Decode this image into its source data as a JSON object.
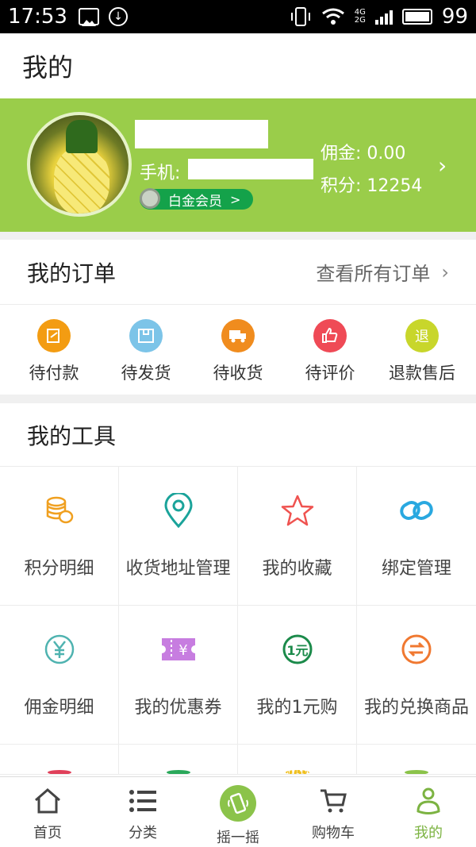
{
  "status_bar": {
    "time": "17:53",
    "battery": "99"
  },
  "header": {
    "title": "我的"
  },
  "profile": {
    "phone_label": "手机:",
    "member_level": "白金会员",
    "member_chevron": ">",
    "commission": "佣金: 0.00",
    "points": "积分: 12254"
  },
  "orders": {
    "title": "我的订单",
    "view_all": "查看所有订单",
    "items": [
      {
        "label": "待付款",
        "color": "#f39c12",
        "icon": "wallet-icon"
      },
      {
        "label": "待发货",
        "color": "#7cc4e8",
        "icon": "box-icon"
      },
      {
        "label": "待收货",
        "color": "#f08c1e",
        "icon": "truck-icon"
      },
      {
        "label": "待评价",
        "color": "#ef4a56",
        "icon": "thumbs-up-icon"
      },
      {
        "label": "退款售后",
        "color": "#c8d62b",
        "icon_text": "退",
        "icon": "refund-icon"
      }
    ]
  },
  "tools": {
    "title": "我的工具",
    "items": [
      {
        "label": "积分明细",
        "icon": "coins-icon",
        "color": "#f0a020"
      },
      {
        "label": "收货地址管理",
        "icon": "location-pin-icon",
        "color": "#1aa39a"
      },
      {
        "label": "我的收藏",
        "icon": "star-icon",
        "color": "#ef5350"
      },
      {
        "label": "绑定管理",
        "icon": "link-icon",
        "color": "#29a8e0"
      },
      {
        "label": "佣金明细",
        "icon": "yen-circle-icon",
        "color": "#4fb3b0"
      },
      {
        "label": "我的优惠券",
        "icon": "coupon-icon",
        "color": "#c77de0"
      },
      {
        "label": "我的1元购",
        "icon": "one-yuan-icon",
        "color": "#1b8a4a"
      },
      {
        "label": "我的兑换商品",
        "icon": "exchange-icon",
        "color": "#f07830"
      }
    ],
    "partial_colors": [
      "#e0405a",
      "#2aa85a",
      "#f0c020",
      "#8bc34a"
    ]
  },
  "tabbar": {
    "items": [
      {
        "label": "首页",
        "icon": "home-icon"
      },
      {
        "label": "分类",
        "icon": "list-icon"
      },
      {
        "label": "摇一摇",
        "icon": "shake-phone-icon"
      },
      {
        "label": "购物车",
        "icon": "cart-icon"
      },
      {
        "label": "我的",
        "icon": "user-icon",
        "active": true
      }
    ],
    "active_color": "#7cb342"
  }
}
